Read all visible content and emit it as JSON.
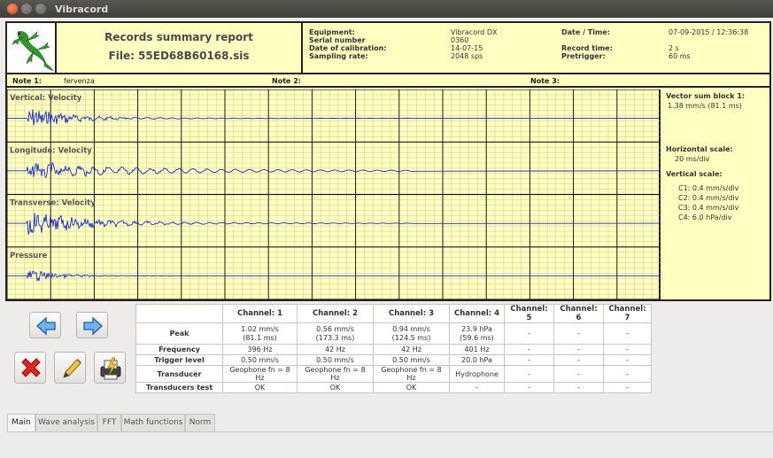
{
  "window": {
    "title": "Vibracord"
  },
  "report": {
    "title": "Records summary report",
    "file": "File: 55ED68B60168.sis",
    "meta": {
      "equipment_label": "Equipment:",
      "equipment_value": "Vibracord DX",
      "serial_label": "Serial number",
      "serial_value": "0360",
      "calibration_label": "Date of calibration:",
      "calibration_value": "14-07-15",
      "sampling_label": "Sampling rate:",
      "sampling_value": "2048 sps",
      "datetime_label": "Date / Time:",
      "datetime_value": "07-09-2015 / 12:36:38",
      "recordtime_label": "Record time:",
      "recordtime_value": "2 s",
      "pretrigger_label": "Pretrigger:",
      "pretrigger_value": "60 ms"
    },
    "notes": {
      "note1_label": "Note 1:",
      "note1_value": "fervenza",
      "note2_label": "Note 2:",
      "note2_value": "",
      "note3_label": "Note 3:",
      "note3_value": ""
    },
    "channels": [
      {
        "label": "Vertical: Velocity",
        "color": "#1a2bd6"
      },
      {
        "label": "Longitude: Velocity",
        "color": "#1a2bd6"
      },
      {
        "label": "Transverse: Velocity",
        "color": "#1a2bd6"
      },
      {
        "label": "Pressure",
        "color": "#1a2bd6"
      }
    ],
    "side": {
      "vector_label": "Vector sum block 1:",
      "vector_value": "1.38 mm/s (81.1 ms)",
      "hscale_label": "Horizontal scale:",
      "hscale_value": "20 ms/div",
      "vscale_label": "Vertical scale:",
      "c1": "C1: 0.4 mm/s/div",
      "c2": "C2: 0.4 mm/s/div",
      "c3": "C3: 0.4 mm/s/div",
      "c4": "C4: 6.0 hPa/div"
    },
    "colors": {
      "background": "#ffffc0",
      "grid_minor": "#c9c98a",
      "grid_major": "#1a1a1a",
      "trace": "#1a2bd6"
    }
  },
  "toolbar": {
    "prev_icon": "left-arrow-icon",
    "next_icon": "right-arrow-icon",
    "delete_icon": "red-x-icon",
    "edit_icon": "pencil-icon",
    "print_icon": "printer-icon"
  },
  "summary_table": {
    "headers": [
      "",
      "Channel: 1",
      "Channel: 2",
      "Channel: 3",
      "Channel: 4",
      "Channel: 5",
      "Channel: 6",
      "Channel: 7"
    ],
    "rows": [
      {
        "label": "Peak",
        "cells": [
          {
            "l1": "1.02 mm/s",
            "l2": "(81.1 ms)"
          },
          {
            "l1": "0.56 mm/s",
            "l2": "(173.3 ms)"
          },
          {
            "l1": "0.94 mm/s",
            "l2": "(124.5 ms)"
          },
          {
            "l1": "23.9 hPa",
            "l2": "(59.6 ms)"
          },
          {
            "l1": "-",
            "l2": ""
          },
          {
            "l1": "-",
            "l2": ""
          },
          {
            "l1": "-",
            "l2": ""
          }
        ]
      },
      {
        "label": "Frequency",
        "cells": [
          "396 Hz",
          "42 Hz",
          "42 Hz",
          "401 Hz",
          "-",
          "-",
          "-"
        ]
      },
      {
        "label": "Trigger level",
        "cells": [
          "0.50 mm/s",
          "0.50 mm/s",
          "0.50 mm/s",
          "20.0 hPa",
          "-",
          "-",
          "-"
        ]
      },
      {
        "label": "Transducer",
        "cells": [
          "Geophone fn = 8 Hz",
          "Geophone fn = 8 Hz",
          "Geophone fn = 8 Hz",
          "Hydrophone",
          "-",
          "-",
          "-"
        ]
      },
      {
        "label": "Transducers test",
        "cells": [
          "OK",
          "OK",
          "OK",
          "-",
          "-",
          "-",
          "-"
        ]
      }
    ]
  },
  "tabs": [
    "Main",
    "Wave analysis",
    "FFT",
    "Math functions",
    "Norm"
  ],
  "active_tab": "Main"
}
